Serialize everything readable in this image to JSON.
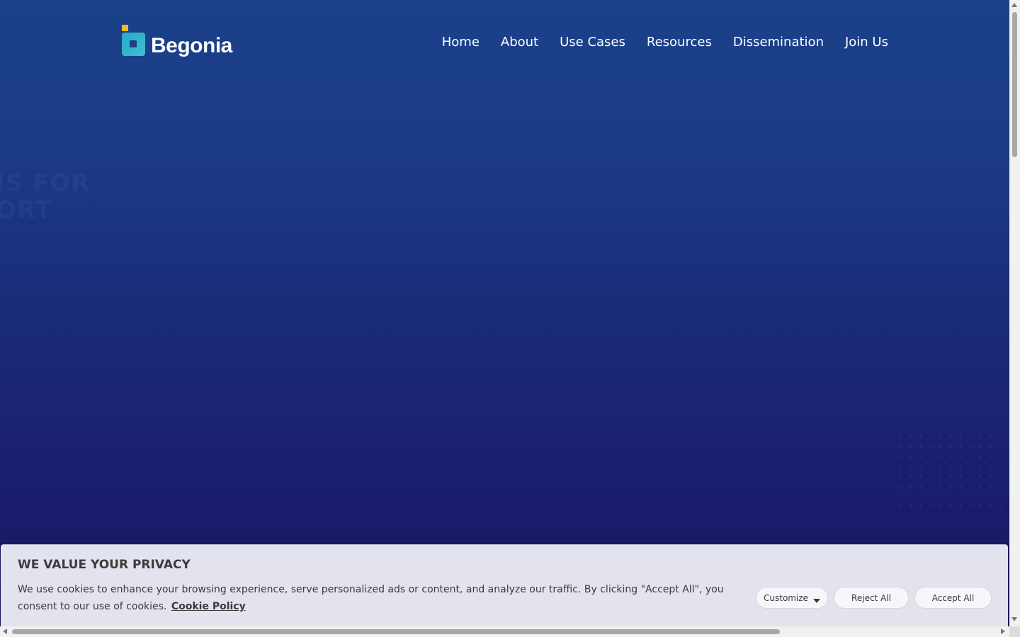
{
  "header": {
    "logo_text": "Begonia",
    "nav": [
      {
        "label": "Home"
      },
      {
        "label": "About"
      },
      {
        "label": "Use Cases"
      },
      {
        "label": "Resources"
      },
      {
        "label": "Dissemination"
      },
      {
        "label": "Join Us"
      }
    ]
  },
  "hero": {
    "ghost_text_line1": "IS FOR",
    "ghost_text_line2": "ORT"
  },
  "cookie": {
    "title": "WE VALUE YOUR PRIVACY",
    "text": "We use cookies to enhance your browsing experience, serve personalized ads or content, and analyze our traffic. By clicking \"Accept All\", you consent to our use of cookies.",
    "policy_link": "Cookie Policy",
    "customize_label": "Customize",
    "reject_label": "Reject All",
    "accept_label": "Accept All"
  },
  "colors": {
    "bg_top": "#1b418a",
    "bg_bottom": "#1b1462",
    "logo_accent_yellow": "#f7b81b",
    "logo_accent_teal": "#3cc1cf",
    "banner_bg": "#e3e3ed"
  }
}
